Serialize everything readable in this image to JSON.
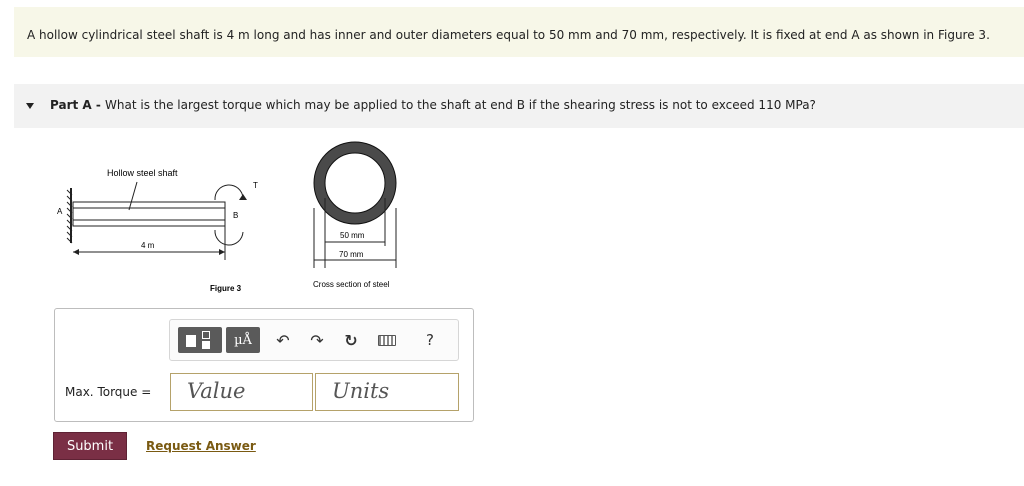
{
  "problem": {
    "text": "A hollow cylindrical steel shaft is 4 m long and has inner and outer diameters equal to 50 mm and 70 mm, respectively. It is fixed at end A as shown in Figure 3."
  },
  "part": {
    "label": "Part A",
    "separator": " - ",
    "question": "What is the largest torque which may be applied to the shaft at end B if the shearing stress is not to exceed 110 MPa?"
  },
  "figure": {
    "shaft_label": "Hollow steel shaft",
    "end_a": "A",
    "end_b": "B",
    "torque_label": "T",
    "length_label": "4 m",
    "figure_caption": "Figure 3",
    "inner_dim": "50 mm",
    "outer_dim": "70 mm",
    "cross_caption": "Cross section of steel"
  },
  "toolbar": {
    "units_button": "µÅ",
    "help": "?"
  },
  "answer": {
    "field_label": "Max. Torque =",
    "value_placeholder": "Value",
    "units_placeholder": "Units"
  },
  "actions": {
    "submit": "Submit",
    "request": "Request Answer"
  }
}
